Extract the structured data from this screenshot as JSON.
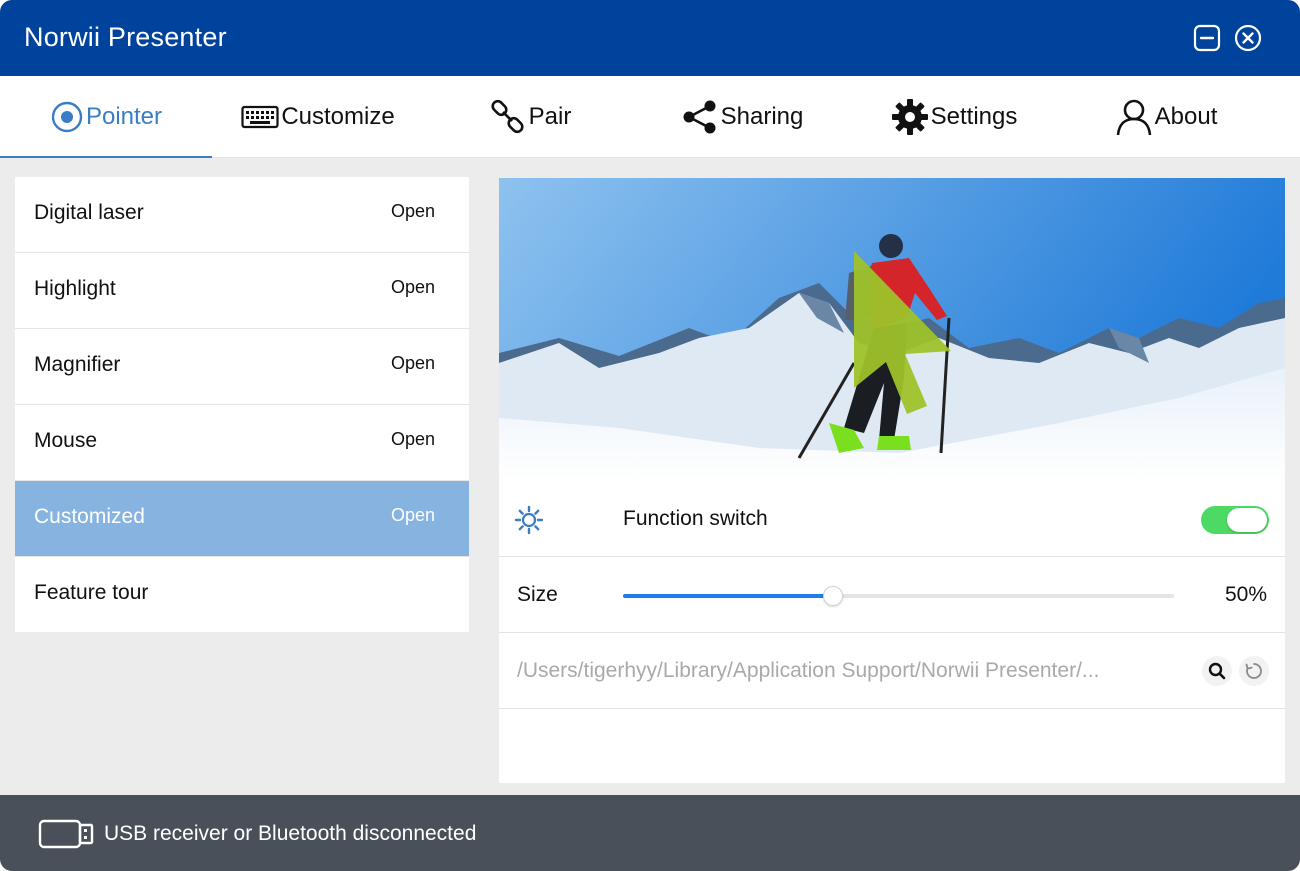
{
  "window": {
    "title": "Norwii Presenter"
  },
  "colors": {
    "titlebar": "#00439c",
    "accent": "#3b7dc4",
    "selected": "#86b3e0",
    "toggle_on": "#4cd964",
    "slider": "#1f7ee6",
    "statusbar": "#4a5059"
  },
  "tabs": [
    {
      "label": "Pointer",
      "icon": "pointer-icon",
      "active": true
    },
    {
      "label": "Customize",
      "icon": "keyboard-icon",
      "active": false
    },
    {
      "label": "Pair",
      "icon": "link-icon",
      "active": false
    },
    {
      "label": "Sharing",
      "icon": "share-icon",
      "active": false
    },
    {
      "label": "Settings",
      "icon": "gear-icon",
      "active": false
    },
    {
      "label": "About",
      "icon": "user-icon",
      "active": false
    }
  ],
  "features": [
    {
      "name": "Digital laser",
      "status": "Open"
    },
    {
      "name": "Highlight",
      "status": "Open"
    },
    {
      "name": "Magnifier",
      "status": "Open"
    },
    {
      "name": "Mouse",
      "status": "Open"
    },
    {
      "name": "Customized",
      "status": "Open",
      "selected": true
    },
    {
      "name": "Feature tour",
      "status": ""
    }
  ],
  "detail": {
    "function_switch": {
      "label": "Function switch",
      "on": true
    },
    "size": {
      "label": "Size",
      "value": "50%",
      "fraction": 0.38
    },
    "path": {
      "text": "/Users/tigerhyy/Library/Application Support/Norwii Presenter/..."
    }
  },
  "status": {
    "text": "USB receiver or Bluetooth disconnected"
  }
}
